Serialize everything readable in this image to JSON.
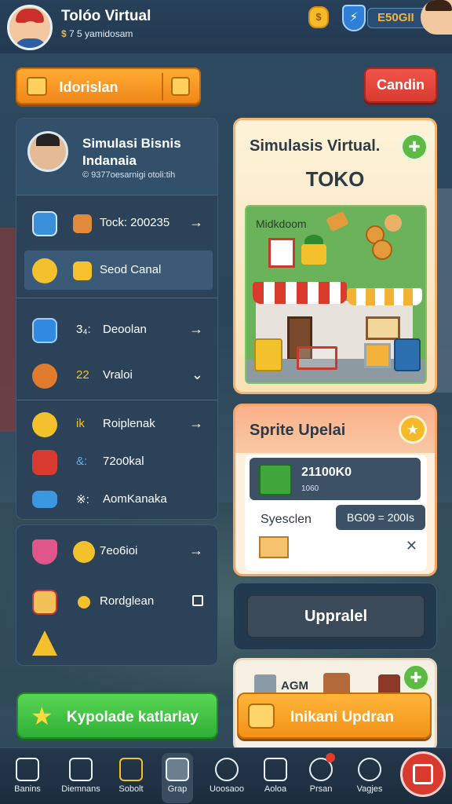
{
  "header": {
    "title": "Tolóo Virtual",
    "subtitle_coin": "$",
    "subtitle": "7 5 yamidosam",
    "stat_value": "E50GII"
  },
  "top_actions": {
    "primary_label": "Idorislan",
    "secondary_label": "Candin"
  },
  "profile": {
    "line1": "Simulasi Bisnis",
    "line2": "Indanaia",
    "line3": "© 9377oesarnigi otoli:tih"
  },
  "menu": [
    {
      "label": "Tock: 200235",
      "trail": "→"
    },
    {
      "label": "Seod Canal",
      "trail": ""
    },
    {
      "label": "Deoolan",
      "prefix": "3₄:",
      "trail": "→"
    },
    {
      "label": "Vraloi",
      "prefix": "22",
      "trail": "⌄"
    },
    {
      "label": "Roiplenak",
      "prefix": "ik",
      "trail": "→"
    },
    {
      "label": "72o0kal",
      "prefix": "&:",
      "trail": ""
    },
    {
      "label": "AomKanaka",
      "prefix": "※:",
      "trail": ""
    }
  ],
  "menu2": [
    {
      "label": "7eo6ioi",
      "trail": "→"
    },
    {
      "label": "Rordglean",
      "trail": "☐"
    }
  ],
  "store_card": {
    "title": "Simulasis Virtual.",
    "store_name": "TOKO",
    "scene_label": "Midkdoom"
  },
  "upgrade_card": {
    "title": "Sprite Upelai",
    "item_value": "21100K0",
    "item_sub": "1060",
    "system_label": "Syesclen",
    "pill": "BG09 = 200Is",
    "close": "✕"
  },
  "upgrade_button": "Uppralel",
  "bottom_card": {
    "label": "AGM"
  },
  "actions": {
    "green_label": "Kypolade katlarlay",
    "orange_label": "Inikani Updran"
  },
  "nav": [
    {
      "label": "Banins"
    },
    {
      "label": "Diemnans"
    },
    {
      "label": "Sobolt"
    },
    {
      "label": "Grap"
    },
    {
      "label": "Uoosaoo"
    },
    {
      "label": "Aoloa"
    },
    {
      "label": "Prsan"
    },
    {
      "label": "Vagjes"
    }
  ]
}
